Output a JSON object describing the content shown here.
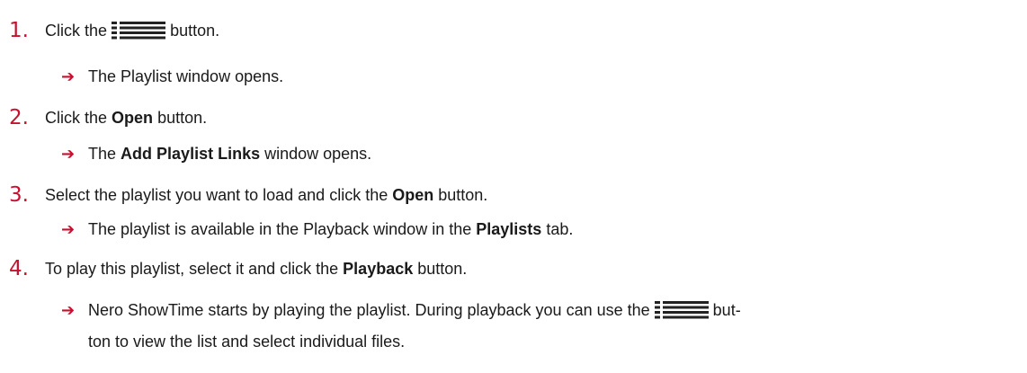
{
  "accent_color": "#c8102e",
  "steps": [
    {
      "number": "1.",
      "text_before": "Click the",
      "icon": "list-menu-icon",
      "text_after": "button.",
      "result": "The Playlist window opens."
    },
    {
      "number": "2.",
      "text_before": "Click the",
      "bold": "Open",
      "text_after": "button.",
      "result_before": "The",
      "result_bold": "Add Playlist Links",
      "result_after": "window opens."
    },
    {
      "number": "3.",
      "text_before": "Select the playlist you want to load and click the",
      "bold": "Open",
      "text_after": "button.",
      "result_before": "The playlist is available in the Playback window in the",
      "result_bold": "Playlists",
      "result_after": "tab."
    },
    {
      "number": "4.",
      "text_before": "To play this playlist, select it and click the",
      "bold": "Playback",
      "text_after": "button.",
      "result_before": "Nero ShowTime starts by playing the playlist. During playback you can use the",
      "result_icon": "list-menu-icon",
      "result_after": "but-",
      "result_line2": "ton to view the list and select individual files."
    }
  ]
}
